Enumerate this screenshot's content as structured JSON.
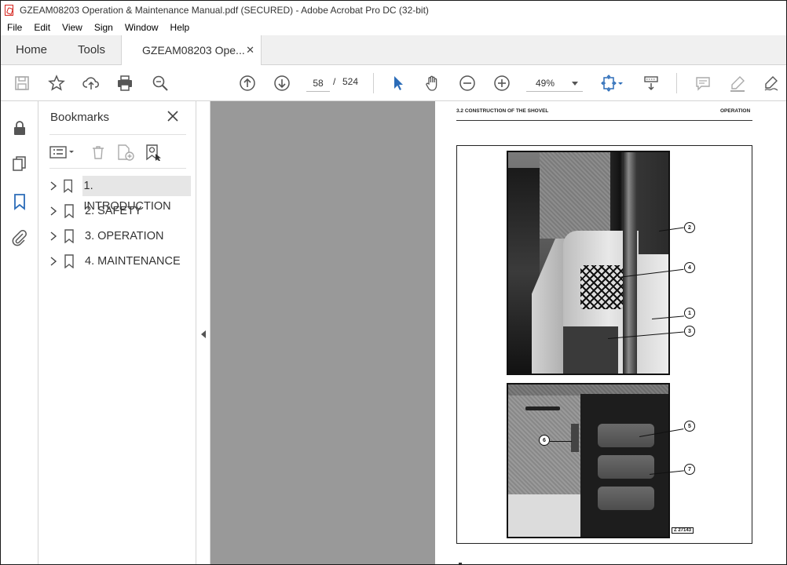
{
  "window": {
    "title": "GZEAM08203 Operation & Maintenance Manual.pdf (SECURED) - Adobe Acrobat Pro DC (32-bit)"
  },
  "menu": {
    "items": [
      "File",
      "Edit",
      "View",
      "Sign",
      "Window",
      "Help"
    ]
  },
  "tabs": {
    "home": "Home",
    "tools": "Tools",
    "doc": "GZEAM08203 Ope...",
    "close": "✕"
  },
  "toolbar": {
    "current_page": "58",
    "page_sep": "/",
    "total_pages": "524",
    "zoom": "49%"
  },
  "bookmarks": {
    "title": "Bookmarks",
    "items": [
      {
        "label": "1. INTRODUCTION",
        "selected": true
      },
      {
        "label": "2. SAFETY",
        "selected": false
      },
      {
        "label": "3. OPERATION",
        "selected": false
      },
      {
        "label": "4. MAINTENANCE",
        "selected": false
      }
    ]
  },
  "page": {
    "header_left": "3.2 CONSTRUCTION OF THE SHOVEL",
    "header_right": "OPERATION",
    "callouts": [
      "1",
      "2",
      "3",
      "4",
      "5",
      "6",
      "7"
    ],
    "figure_ref": "Z 27143"
  },
  "colors": {
    "accent_blue": "#2b6cb8",
    "doc_background": "#999999",
    "acrobat_red": "#d5221b"
  }
}
